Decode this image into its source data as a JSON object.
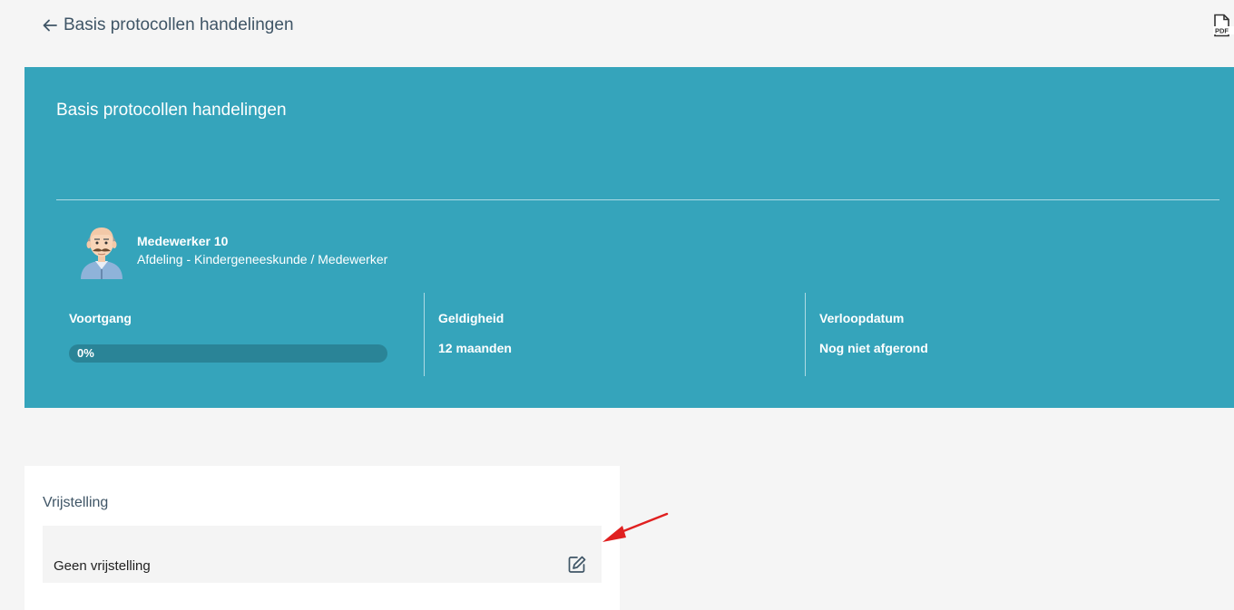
{
  "header": {
    "back_label": "Basis protocollen handelingen",
    "pdf_label": "PDF"
  },
  "hero": {
    "title": "Basis protocollen handelingen",
    "employee": {
      "name": "Medewerker 10",
      "department": "Afdeling - Kindergeneeskunde / Medewerker"
    },
    "stats": {
      "progress_label": "Voortgang",
      "progress_text": "0%",
      "progress_fraction": 0,
      "validity_label": "Geldigheid",
      "validity_value": "12 maanden",
      "expiry_label": "Verloopdatum",
      "expiry_value": "Nog niet afgerond"
    },
    "colors": {
      "background": "#35a4bb",
      "progress_track": "#2a8497"
    }
  },
  "exemption": {
    "title": "Vrijstelling",
    "value": "Geen vrijstelling"
  },
  "icons": {
    "back": "arrow-left-icon",
    "pdf": "pdf-file-icon",
    "edit": "edit-pencil-icon",
    "annotation": "red-arrow-icon"
  }
}
